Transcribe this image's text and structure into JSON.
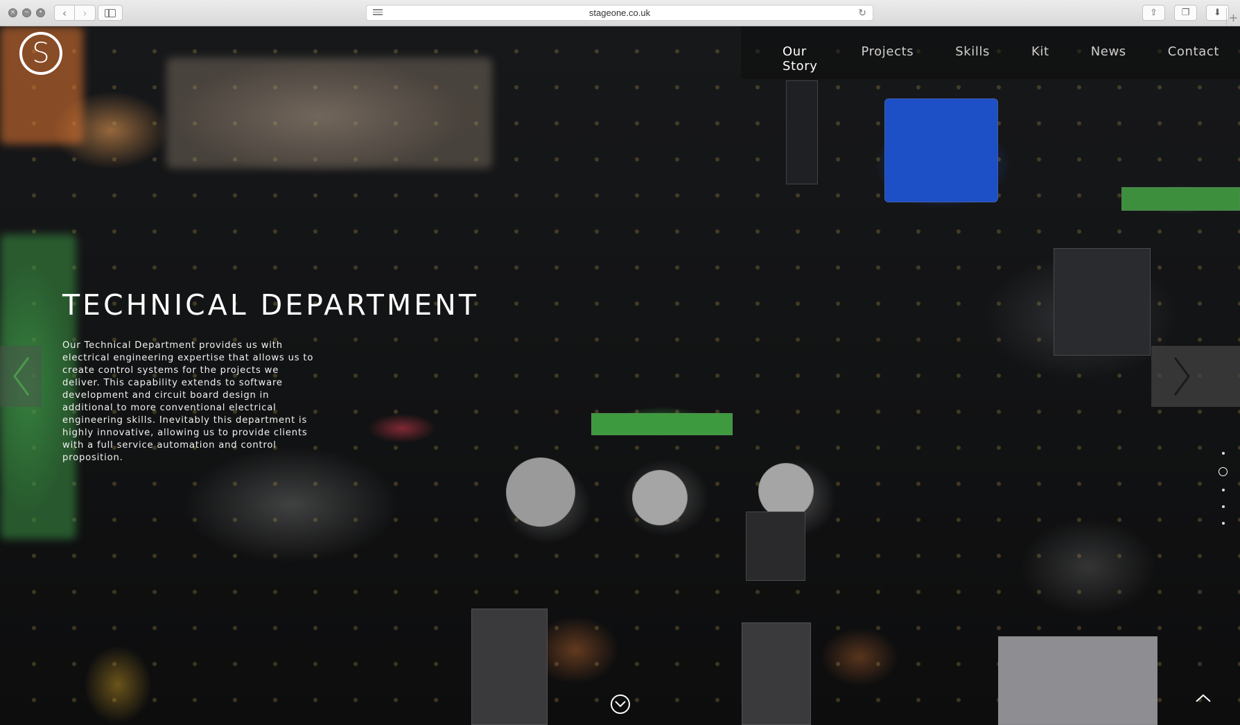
{
  "browser": {
    "url": "stageone.co.uk",
    "traffic_lights": [
      "close-icon",
      "minimize-icon",
      "fullscreen-icon"
    ],
    "back_glyph": "‹",
    "forward_glyph": "›",
    "reload_glyph": "↻",
    "share_glyph": "⇧",
    "tabs_glyph": "❐",
    "download_glyph": "⬇",
    "new_tab_glyph": "+"
  },
  "site": {
    "logo_letter": "S",
    "nav": [
      {
        "label": "Our Story",
        "active": true
      },
      {
        "label": "Projects",
        "active": false
      },
      {
        "label": "Skills",
        "active": false
      },
      {
        "label": "Kit",
        "active": false
      },
      {
        "label": "News",
        "active": false
      },
      {
        "label": "Contact",
        "active": false
      }
    ]
  },
  "hero": {
    "title": "TECHNICAL DEPARTMENT",
    "body": "Our Technical Department provides us with electrical engineering expertise that allows us to create control systems for the projects we deliver. This capability extends to software development and circuit board design in additional to more conventional electrical engineering skills. Inevitably this department is highly innovative, allowing us to provide clients with a full service automation and control proposition."
  },
  "section_dots": {
    "count": 5,
    "active_index": 1
  },
  "colors": {
    "accent_orange": "#f0822c",
    "board_black": "#121314",
    "text_white": "#ffffff"
  },
  "icons": {
    "prev_slide": "chevron-left-icon",
    "next_slide": "chevron-right-icon",
    "scroll_down": "chevron-down-circle-icon",
    "back_to_top": "chevron-up-icon"
  }
}
